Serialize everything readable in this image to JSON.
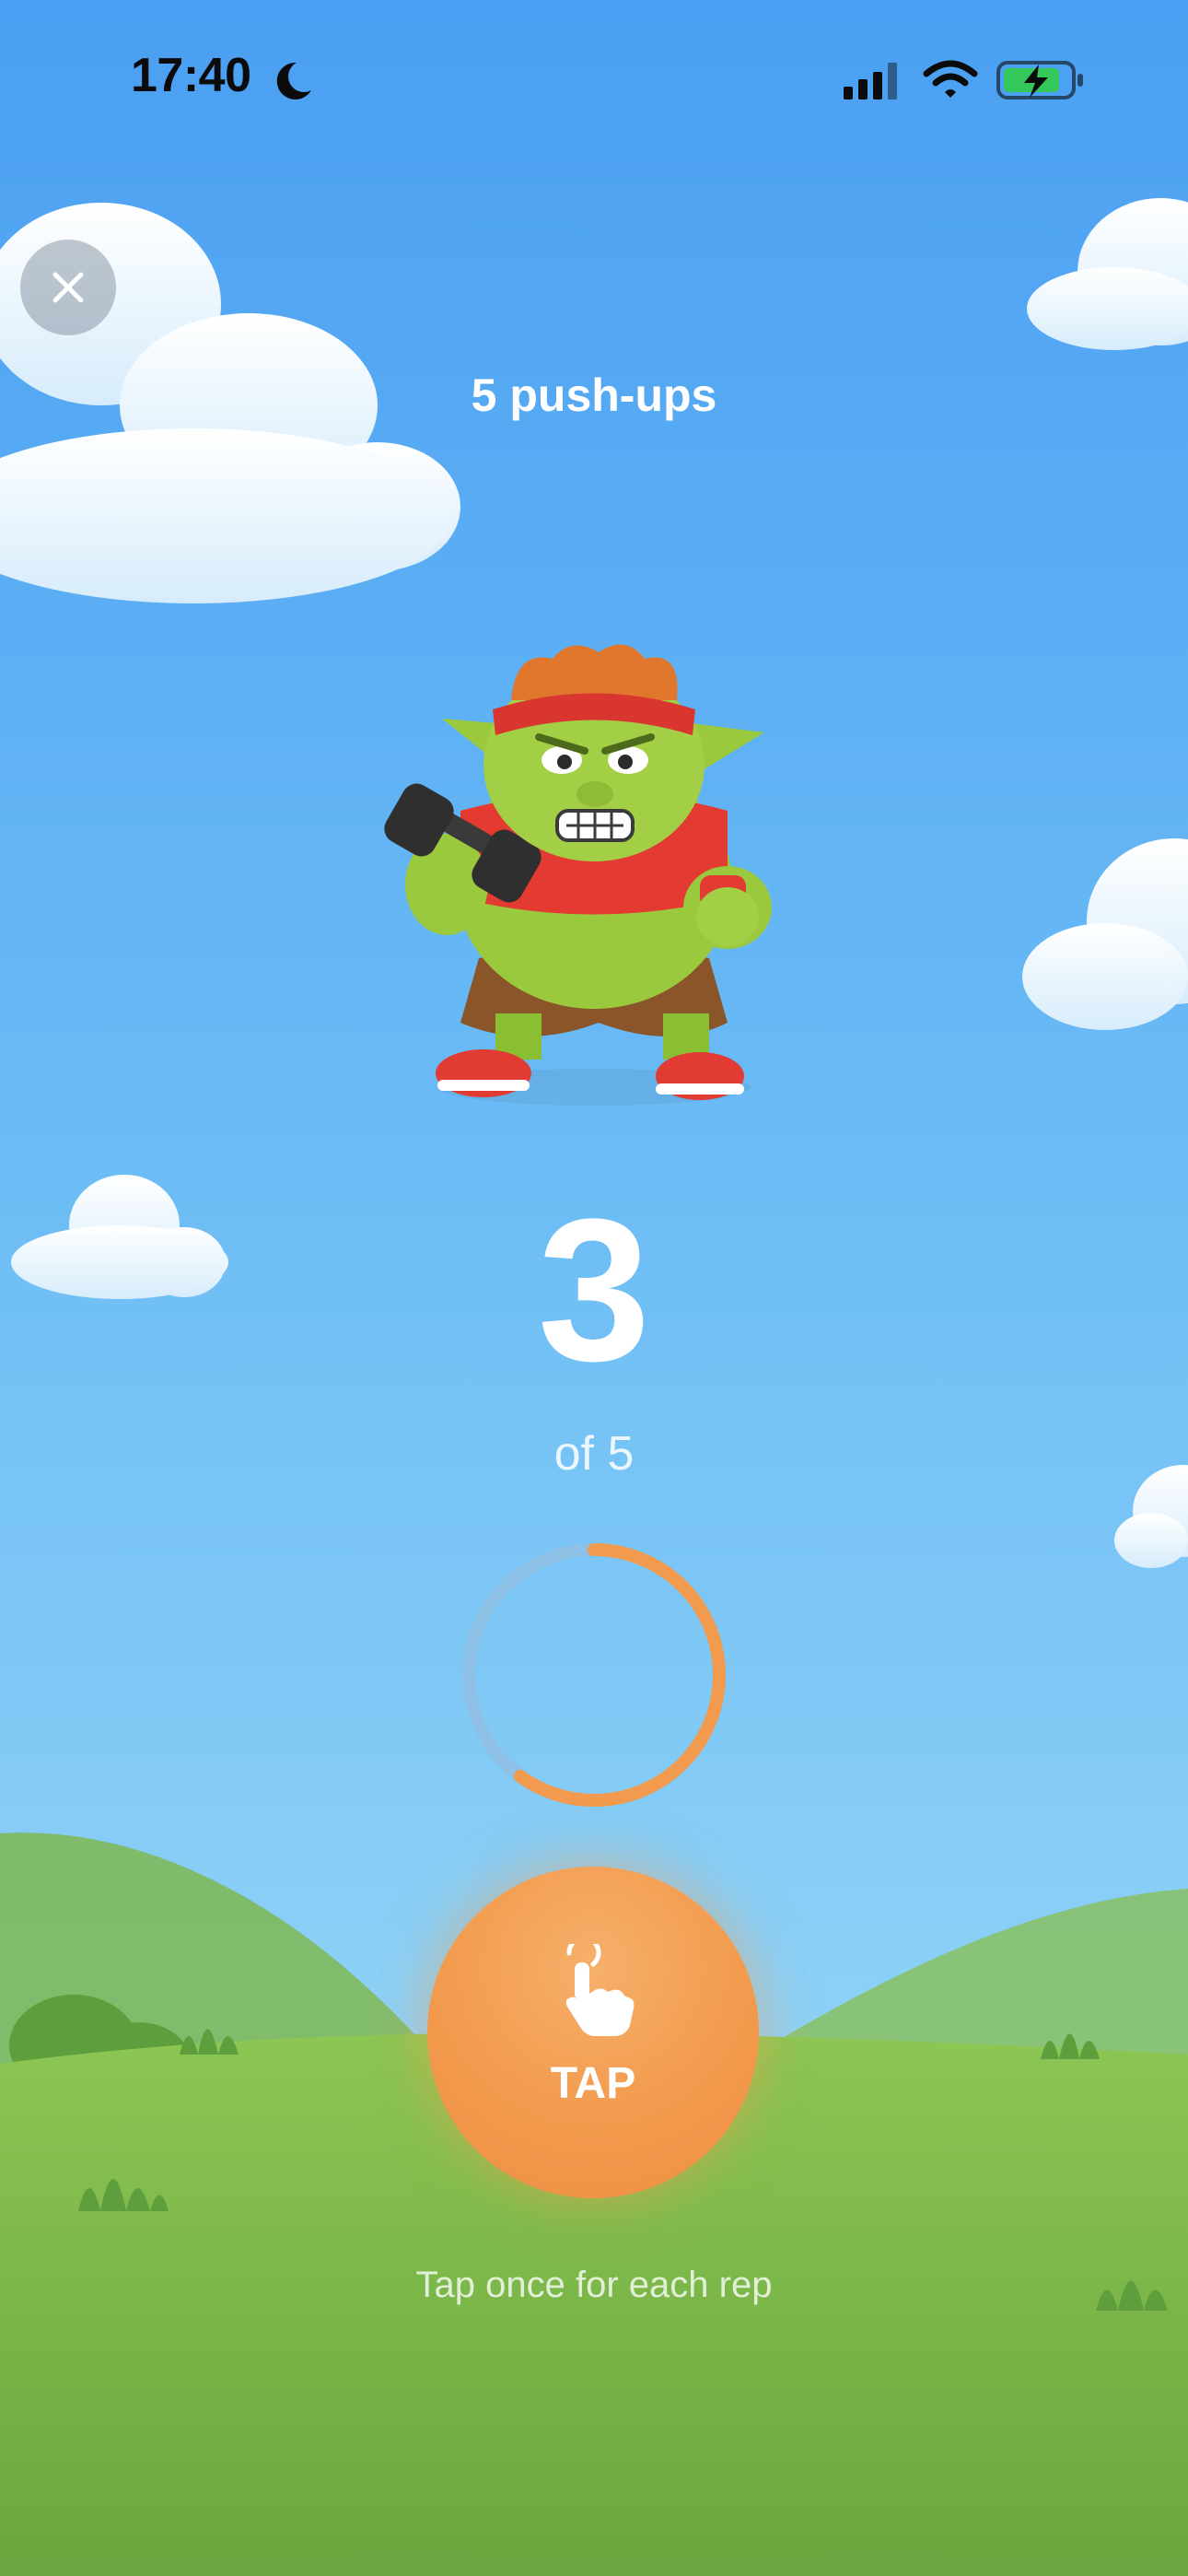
{
  "status_bar": {
    "time": "17:40",
    "icons": [
      "moon-icon",
      "cellular-signal-icon",
      "wifi-icon",
      "battery-charging-icon"
    ]
  },
  "header": {
    "close_icon": "close-icon",
    "title": "5 push-ups"
  },
  "counter": {
    "current": "3",
    "of_label": "of 5",
    "progress": 0.6
  },
  "tap_button": {
    "icon": "hand-pointer-icon",
    "label": "TAP"
  },
  "hint": "Tap once for each rep",
  "colors": {
    "sky_top": "#4da3f2",
    "sky_bottom": "#9fdcf6",
    "grass": "#86bf4b",
    "accent": "#f29a4d",
    "ring_track": "#8fc0e3"
  }
}
